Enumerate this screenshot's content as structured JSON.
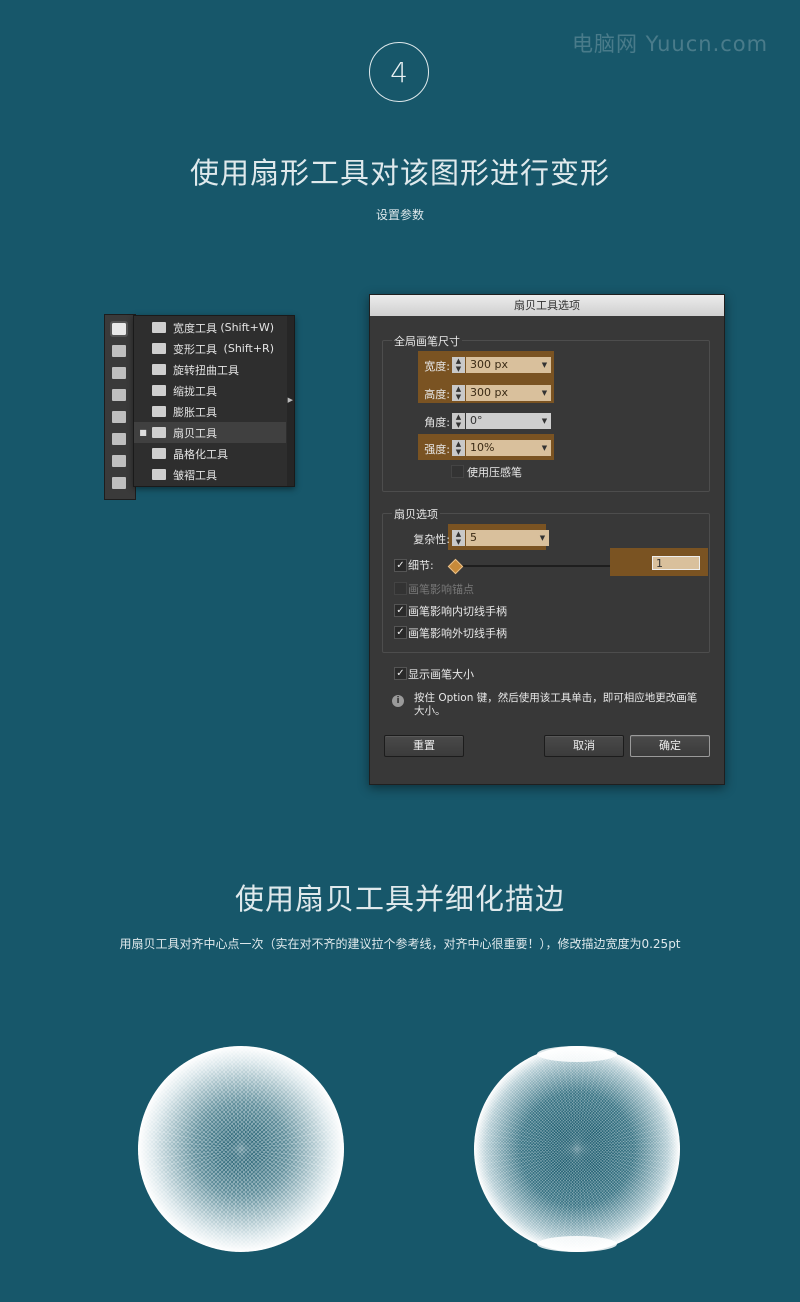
{
  "watermark": "电脑网 Yuucn.com",
  "step": "4",
  "section1": {
    "title": "使用扇形工具对该图形进行变形",
    "subtitle": "设置参数"
  },
  "flyout": {
    "items": [
      {
        "label": "宽度工具",
        "shortcut": "(Shift+W)",
        "icon": "width-tool-icon"
      },
      {
        "label": "变形工具",
        "shortcut": "(Shift+R)",
        "icon": "warp-tool-icon"
      },
      {
        "label": "旋转扭曲工具",
        "shortcut": "",
        "icon": "twirl-tool-icon"
      },
      {
        "label": "缩拢工具",
        "shortcut": "",
        "icon": "pucker-tool-icon"
      },
      {
        "label": "膨胀工具",
        "shortcut": "",
        "icon": "bloat-tool-icon"
      },
      {
        "label": "扇贝工具",
        "shortcut": "",
        "icon": "scallop-tool-icon",
        "active": true
      },
      {
        "label": "晶格化工具",
        "shortcut": "",
        "icon": "crystallize-tool-icon"
      },
      {
        "label": "皱褶工具",
        "shortcut": "",
        "icon": "wrinkle-tool-icon"
      }
    ]
  },
  "dialog": {
    "title": "扇贝工具选项",
    "global": {
      "group_label": "全局画笔尺寸",
      "width_label": "宽度:",
      "width_value": "300 px",
      "height_label": "高度:",
      "height_value": "300 px",
      "angle_label": "角度:",
      "angle_value": "0°",
      "intensity_label": "强度:",
      "intensity_value": "10%",
      "pressure_label": "使用压感笔"
    },
    "scallop": {
      "group_label": "扇贝选项",
      "complexity_label": "复杂性:",
      "complexity_value": "5",
      "detail_label": "细节:",
      "detail_value": "1",
      "detail_fraction": 0,
      "anchor_label": "画笔影响锚点",
      "in_tangent_label": "画笔影响内切线手柄",
      "out_tangent_label": "画笔影响外切线手柄"
    },
    "show_brush_label": "显示画笔大小",
    "info": "按住 Option 键，然后使用该工具单击，即可相应地更改画笔大小。",
    "buttons": {
      "reset": "重置",
      "cancel": "取消",
      "ok": "确定"
    }
  },
  "section2": {
    "title": "使用扇贝工具并细化描边",
    "subtitle": "用扇贝工具对齐中心点一次（实在对不齐的建议拉个参考线，对齐中心很重要！），修改描边宽度为0.25pt"
  },
  "colors": {
    "background": "#17576a",
    "highlight": "#7a5322",
    "field": "#d9c09c",
    "dialog": "#383838"
  }
}
